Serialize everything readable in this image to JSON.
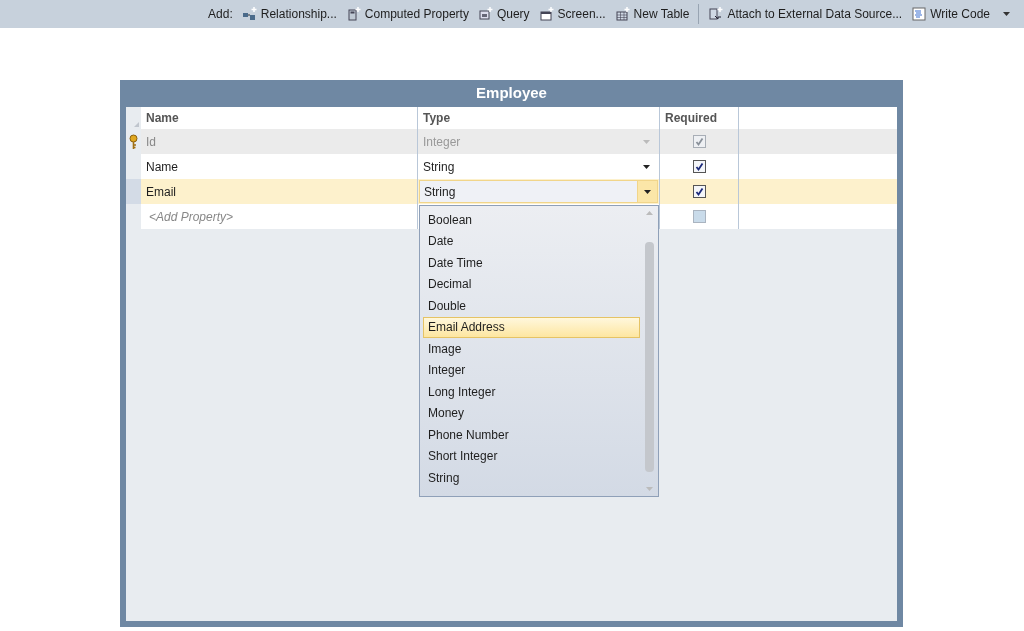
{
  "toolbar": {
    "label": "Add:",
    "items": [
      {
        "label": "Relationship..."
      },
      {
        "label": "Computed Property"
      },
      {
        "label": "Query"
      },
      {
        "label": "Screen..."
      },
      {
        "label": "New Table"
      },
      {
        "label": "Attach to External Data Source..."
      },
      {
        "label": "Write Code",
        "dropdown": true
      }
    ]
  },
  "table": {
    "title": "Employee",
    "columns": [
      "Name",
      "Type",
      "Required"
    ],
    "rows": [
      {
        "name": "Id",
        "type": "Integer",
        "required": true,
        "key": true,
        "disabled": true,
        "selected": false,
        "kind": "property"
      },
      {
        "name": "Name",
        "type": "String",
        "required": true,
        "key": false,
        "disabled": false,
        "selected": false,
        "kind": "property"
      },
      {
        "name": "Email",
        "type": "String",
        "required": true,
        "key": false,
        "disabled": false,
        "selected": true,
        "kind": "property"
      },
      {
        "name": "<Add Property>",
        "required": false,
        "key": false,
        "disabled": false,
        "selected": false,
        "kind": "new"
      }
    ]
  },
  "type_dropdown": {
    "options": [
      {
        "label": "Boolean",
        "selected": false
      },
      {
        "label": "Date",
        "selected": false
      },
      {
        "label": "Date Time",
        "selected": false
      },
      {
        "label": "Decimal",
        "selected": false
      },
      {
        "label": "Double",
        "selected": false
      },
      {
        "label": "Email Address",
        "selected": true
      },
      {
        "label": "Image",
        "selected": false
      },
      {
        "label": "Integer",
        "selected": false
      },
      {
        "label": "Long Integer",
        "selected": false
      },
      {
        "label": "Money",
        "selected": false
      },
      {
        "label": "Phone Number",
        "selected": false
      },
      {
        "label": "Short Integer",
        "selected": false
      },
      {
        "label": "String",
        "selected": false
      }
    ]
  }
}
